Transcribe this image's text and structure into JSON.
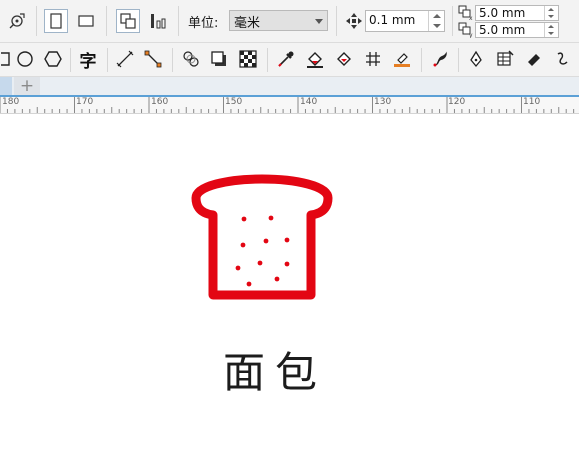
{
  "toolbar": {
    "unit_label": "单位:",
    "unit_value": "毫米",
    "nudge_value": "0.1 mm",
    "dup_x": "5.0 mm",
    "dup_y": "5.0 mm"
  },
  "text_tool_label": "字",
  "tab_add_symbol": "+",
  "ruler": {
    "labels": [
      "180",
      "170",
      "160",
      "150",
      "140",
      "130",
      "120",
      "110"
    ]
  },
  "canvas": {
    "caption": "面包",
    "icon_color": "#e30613",
    "icon_name": "bread-icon"
  }
}
